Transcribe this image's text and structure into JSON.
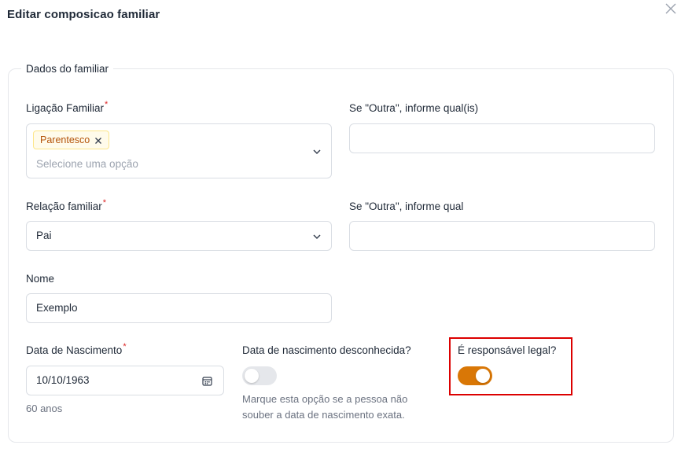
{
  "modal": {
    "title": "Editar composicao familiar"
  },
  "section": {
    "legend": "Dados do familiar"
  },
  "ligacao": {
    "label": "Ligação Familiar",
    "required_mark": "*",
    "tag": "Parentesco",
    "placeholder": "Selecione uma opção"
  },
  "outra_quais": {
    "label": "Se \"Outra\", informe qual(is)",
    "value": ""
  },
  "relacao": {
    "label": "Relação familiar",
    "required_mark": "*",
    "value": "Pai"
  },
  "outra_qual": {
    "label": "Se \"Outra\", informe qual",
    "value": ""
  },
  "nome": {
    "label": "Nome",
    "value": "Exemplo"
  },
  "nascimento": {
    "label": "Data de Nascimento",
    "required_mark": "*",
    "value": "10/10/1963",
    "age": "60 anos"
  },
  "desconhecida": {
    "label": "Data de nascimento desconhecida?",
    "checked": false,
    "helper_line1": "Marque esta opção se a pessoa não",
    "helper_line2": "souber a data de nascimento exata."
  },
  "responsavel": {
    "label": "É responsável legal?",
    "checked": true
  },
  "colors": {
    "accent": "#d97706",
    "required": "#dc2626",
    "highlight": "#dc0000"
  }
}
